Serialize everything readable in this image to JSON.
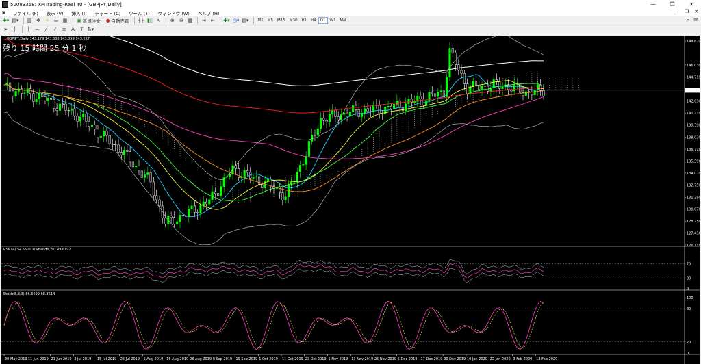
{
  "window": {
    "title": "50083358: XMTrading-Real 40 - [GBPJPY,Daily]"
  },
  "menu": [
    "ファイル (F)",
    "表示 (V)",
    "挿入 (I)",
    "チャート (C)",
    "ツール (T)",
    "ウィンドウ (W)",
    "ヘルプ (H)"
  ],
  "toolbar": {
    "new_order": "新規注文",
    "auto_trade": "自動売買",
    "timeframes": [
      "M1",
      "M5",
      "M15",
      "M30",
      "H1",
      "H4",
      "D1",
      "W1",
      "MN"
    ],
    "selected_tf": "D1"
  },
  "chart": {
    "header": "GBPJPY,Daily  143.179 143.388 143.099 143.227",
    "timer": "残り 15 時間 25 分 1 秒",
    "price_labels": [
      "148.670",
      "146.030",
      "144.710",
      "143.227",
      "142.030",
      "140.710",
      "139.390",
      "138.030",
      "136.710",
      "135.390",
      "134.070",
      "132.750",
      "131.390",
      "130.070",
      "128.750",
      "127.430",
      "126.110"
    ],
    "current_price": "143.227",
    "dates": [
      "30 May 2019",
      "11 Jun 2019",
      "21 Jun 2019",
      "3 Jul 2019",
      "15 Jul 2019",
      "25 Jul 2019",
      "6 Aug 2019",
      "16 Aug 2019",
      "28 Aug 2019",
      "9 Sep 2019",
      "19 Sep 2019",
      "1 Oct 2019",
      "11 Oct 2019",
      "23 Oct 2019",
      "1 Nov 2019",
      "13 Nov 2019",
      "25 Nov 2019",
      "5 Dec 2019",
      "17 Dec 2019",
      "30 Dec 2019",
      "10 Jan 2020",
      "22 Jan 2020",
      "3 Feb 2020",
      "13 Feb 2020"
    ]
  },
  "rsi": {
    "header": "RSI(14) 54.5520   =>Bands(20) 49.6192",
    "levels": [
      "70",
      "30",
      "0"
    ]
  },
  "stoch": {
    "header": "Stoch(5,3,3) 86.6699 68.8514",
    "levels": [
      "100",
      "80",
      "20",
      "0"
    ]
  },
  "colors": {
    "bull": "#00ff00",
    "bear": "#ffffff",
    "bg": "#000000",
    "ma_red": "#ff2020",
    "ma_magenta": "#ff40c0",
    "ma_yellow": "#ffff40",
    "ma_cyan": "#20d0ff",
    "ma_orange": "#ff9020",
    "ma_green": "#40ff40"
  }
}
